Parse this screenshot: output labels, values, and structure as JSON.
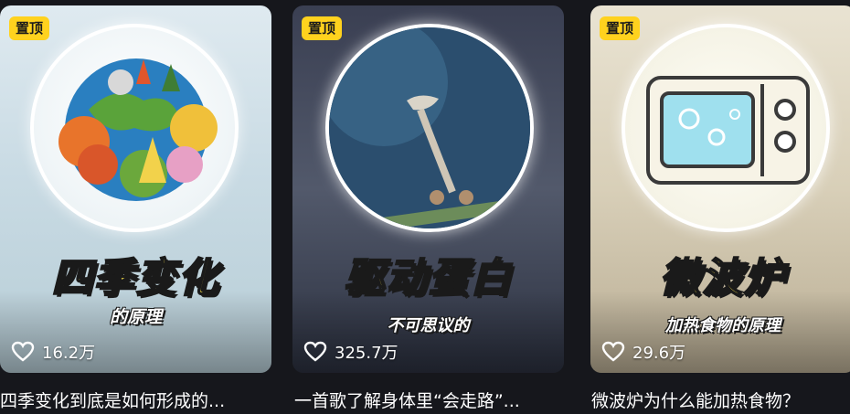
{
  "cards": [
    {
      "badge": "置顶",
      "title": "四季变化",
      "subtitle": "的原理",
      "likes": "16.2万",
      "caption": "四季变化到底是如何形成的...",
      "icon": "earth-trees-illustration"
    },
    {
      "badge": "置顶",
      "title": "驱动蛋白",
      "subtitle": "不可思议的",
      "likes": "325.7万",
      "caption": "一首歌了解身体里“会走路”...",
      "icon": "kinesin-protein-illustration"
    },
    {
      "badge": "置顶",
      "title": "微波炉",
      "subtitle": "加热食物的原理",
      "likes": "29.6万",
      "caption": "微波炉为什么能加热食物？",
      "icon": "microwave-illustration"
    }
  ],
  "colors": {
    "badge_bg": "#ffd21e",
    "title_fill": "#ffe44a",
    "page_bg": "#16171c"
  }
}
